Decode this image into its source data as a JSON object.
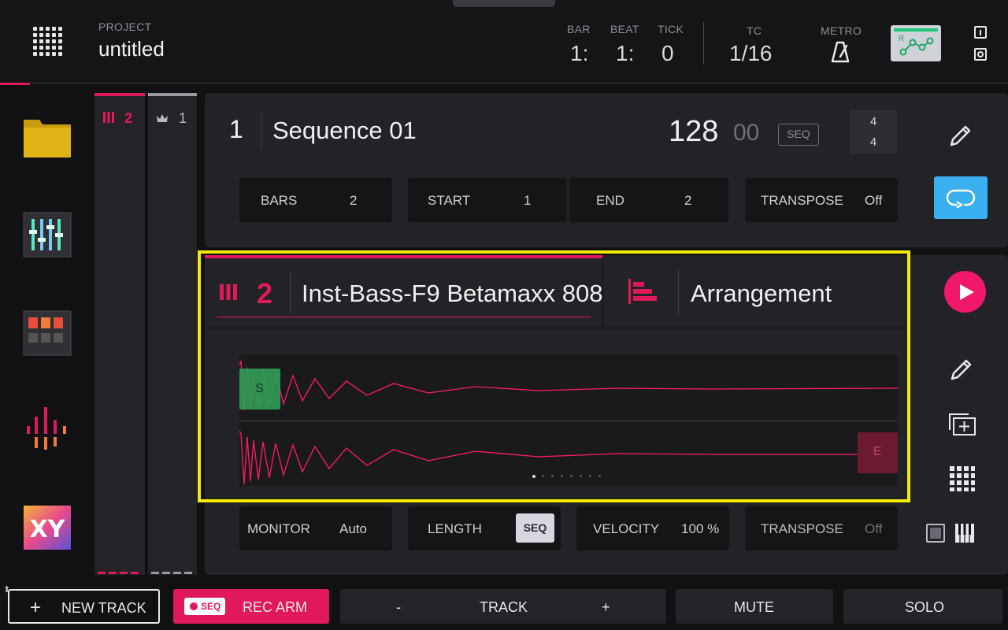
{
  "header": {
    "project_label": "PROJECT",
    "project_name": "untitled",
    "bar_label": "BAR",
    "bar_value": "1:",
    "beat_label": "BEAT",
    "beat_value": "1:",
    "tick_label": "TICK",
    "tick_value": "0",
    "tc_label": "TC",
    "tc_value": "1/16",
    "metro_label": "METRO",
    "automation_letter": "R"
  },
  "sidebar": {
    "items": [
      "browser",
      "mixer",
      "channel-mixer",
      "sample-edit",
      "xyfx"
    ]
  },
  "tracks": {
    "tab_inst_number": "2",
    "tab_master_number": "1"
  },
  "sequence": {
    "number": "1",
    "name": "Sequence 01",
    "bpm_whole": "128",
    "bpm_fraction": "00",
    "bpm_mode": "SEQ",
    "time_sig_top": "4",
    "time_sig_bottom": "4",
    "params": [
      {
        "label": "BARS",
        "value": "2"
      },
      {
        "label": "START",
        "value": "1"
      },
      {
        "label": "END",
        "value": "2"
      },
      {
        "label": "TRANSPOSE",
        "value": "Off"
      }
    ]
  },
  "track": {
    "number": "2",
    "name": "Inst-Bass-F9 Betamaxx 808",
    "view_name": "Arrangement",
    "start_marker": "S",
    "end_marker": "E",
    "params": [
      {
        "label": "MONITOR",
        "value": "Auto"
      },
      {
        "label": "LENGTH",
        "value": "SEQ"
      },
      {
        "label": "VELOCITY",
        "value": "100 %"
      },
      {
        "label": "TRANSPOSE",
        "value": "Off"
      }
    ]
  },
  "bottom": {
    "new_track": "NEW TRACK",
    "rec_badge": "SEQ",
    "rec_arm": "REC ARM",
    "track_minus": "-",
    "track_label": "TRACK",
    "track_plus": "+",
    "mute": "MUTE",
    "solo": "SOLO"
  },
  "colors": {
    "accent": "#e0195a",
    "loop_active": "#3ab0f0",
    "highlight_frame": "#f5ec00",
    "start_marker": "#2f9a55"
  }
}
